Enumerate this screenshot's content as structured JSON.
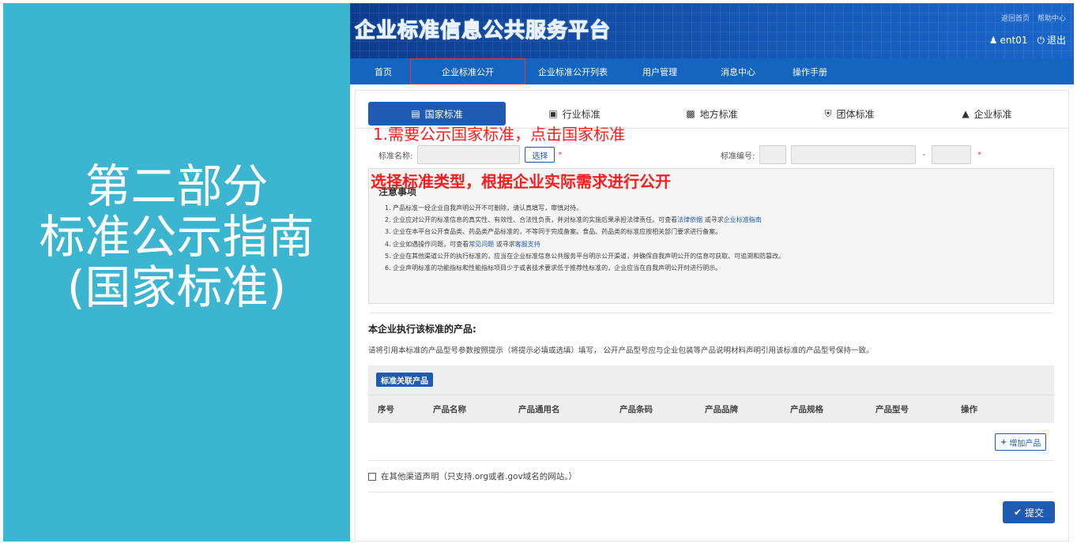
{
  "slide": {
    "title_lines": [
      "第二部分",
      "标准公示指南",
      "(国家标准)"
    ]
  },
  "header": {
    "logo": "企业标准信息公共服务平台",
    "top_links": [
      "返回首页",
      "帮助中心"
    ],
    "user": "ent01",
    "logout": "退出"
  },
  "nav": {
    "items": [
      {
        "label": "首页",
        "active": false
      },
      {
        "label": "企业标准公开",
        "active": true
      },
      {
        "label": "企业标准公开列表",
        "active": false
      },
      {
        "label": "用户管理",
        "active": false
      },
      {
        "label": "消息中心",
        "active": false
      },
      {
        "label": "操作手册",
        "active": false
      }
    ]
  },
  "tabs": [
    {
      "label": "国家标准",
      "icon": "book-icon",
      "active": true
    },
    {
      "label": "行业标准",
      "icon": "briefcase-icon",
      "active": false
    },
    {
      "label": "地方标准",
      "icon": "document-icon",
      "active": false
    },
    {
      "label": "团体标准",
      "icon": "shield-icon",
      "active": false
    },
    {
      "label": "企业标准",
      "icon": "bank-icon",
      "active": false
    }
  ],
  "annotations": {
    "step1": "1.需要公示国家标准，点击国家标准",
    "step2": "选择标准类型，根据企业实际需求进行公开"
  },
  "form": {
    "name_label": "标准名称:",
    "select_button": "选择",
    "required_mark": "*",
    "number_label": "标准编号:",
    "dash": "-"
  },
  "notice": {
    "title": "注意事项",
    "items": [
      {
        "text": "1. 产品标准一经企业自我声明公开不可删除，请认真填写，审慎对待。"
      },
      {
        "text": "2. 企业应对公开的标准信息的真实性、有效性、合法性负责，并对标准的实施后果承担法律责任。可查看",
        "link1": "法律依据",
        "mid": " 或寻求",
        "link2": "企业标准指南"
      },
      {
        "text": "3. 企业在本平台公开食品类、药品类产品标准的，不等同于完成备案。食品、药品类的标准应按相关部门要求进行备案。"
      },
      {
        "text": "4. 企业如遇操作问题，可查看",
        "link1": "常见问题",
        "mid": " 或寻求",
        "link2": "客服支持"
      },
      {
        "text": "5. 企业在其他渠道公开的执行标准的，应当在企业标准信息公共服务平台明示公开渠道，并确保自我声明公开的信息可获取、可追溯和防篡改。"
      },
      {
        "text": "6. 企业声明标准的功能指标和性能指标项目少于或者技术要求低于推荐性标准的，企业应当在自我声明公开时进行明示。"
      }
    ]
  },
  "products": {
    "title": "本企业执行该标准的产品:",
    "desc": "请将引用本标准的产品型号参数按照提示（将提示必填或选填）填写， 公开产品型号应与企业包装等产品说明材料声明引用该标准的产品型号保持一致。",
    "badge": "标准关联产品",
    "columns": [
      "序号",
      "产品名称",
      "产品通用名",
      "产品条码",
      "产品品牌",
      "产品规格",
      "产品型号",
      "操作"
    ],
    "add_button": "增加产品"
  },
  "other_channel": "在其他渠道声明（只支持.org或者.gov域名的网站。）",
  "submit": "提交",
  "colors": {
    "slide_accent": "#3bb5d0",
    "primary": "#1f5bb3",
    "nav": "#1565c0",
    "annotation": "#ff1a1a"
  }
}
